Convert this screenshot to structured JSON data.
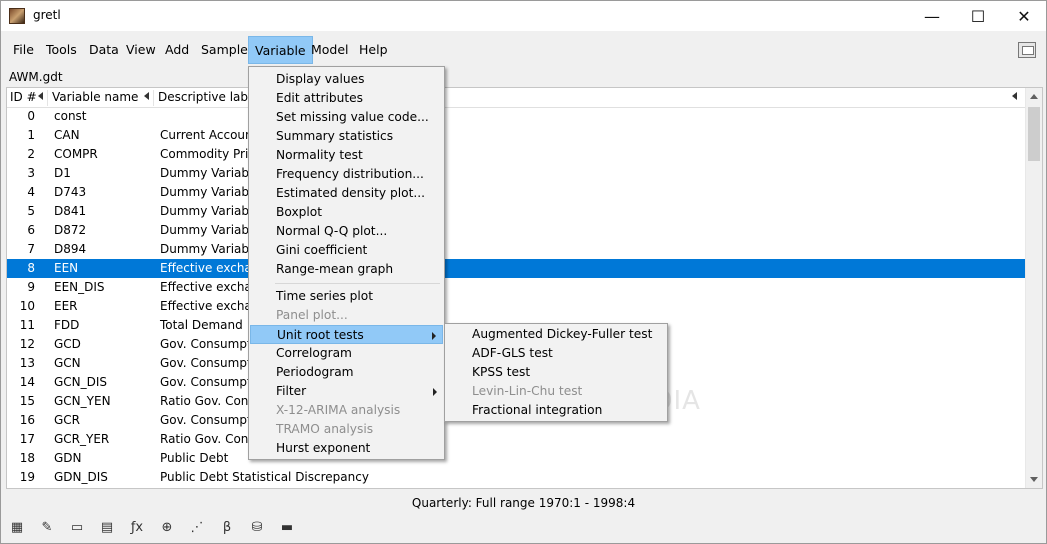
{
  "window": {
    "title": "gretl",
    "minimize": "—",
    "maximize": "☐",
    "close": "✕"
  },
  "menubar": [
    "File",
    "Tools",
    "Data",
    "View",
    "Add",
    "Sample",
    "Variable",
    "Model",
    "Help"
  ],
  "filename": "AWM.gdt",
  "list": {
    "headers": {
      "id": "ID #",
      "name": "Variable name",
      "desc": "Descriptive label"
    },
    "rows": [
      {
        "id": "0",
        "name": "const",
        "desc": ""
      },
      {
        "id": "1",
        "name": "CAN",
        "desc": "Current Account"
      },
      {
        "id": "2",
        "name": "COMPR",
        "desc": "Commodity Pric"
      },
      {
        "id": "3",
        "name": "D1",
        "desc": "Dummy Variable"
      },
      {
        "id": "4",
        "name": "D743",
        "desc": "Dummy Variable"
      },
      {
        "id": "5",
        "name": "D841",
        "desc": "Dummy Variable"
      },
      {
        "id": "6",
        "name": "D872",
        "desc": "Dummy Variable"
      },
      {
        "id": "7",
        "name": "D894",
        "desc": "Dummy Variable"
      },
      {
        "id": "8",
        "name": "EEN",
        "desc": "Effective exchang"
      },
      {
        "id": "9",
        "name": "EEN_DIS",
        "desc": "Effective exchang"
      },
      {
        "id": "10",
        "name": "EER",
        "desc": "Effective exchang"
      },
      {
        "id": "11",
        "name": "FDD",
        "desc": "Total Demand"
      },
      {
        "id": "12",
        "name": "GCD",
        "desc": "Gov. Consumptio"
      },
      {
        "id": "13",
        "name": "GCN",
        "desc": "Gov. Consumptio"
      },
      {
        "id": "14",
        "name": "GCN_DIS",
        "desc": "Gov. Consumptio"
      },
      {
        "id": "15",
        "name": "GCN_YEN",
        "desc": "Ratio Gov. Consu"
      },
      {
        "id": "16",
        "name": "GCR",
        "desc": "Gov. Consumptio"
      },
      {
        "id": "17",
        "name": "GCR_YER",
        "desc": "Ratio Gov. Consu"
      },
      {
        "id": "18",
        "name": "GDN",
        "desc": "Public Debt"
      },
      {
        "id": "19",
        "name": "GDN_DIS",
        "desc": "Public Debt Statistical Discrepancy"
      }
    ]
  },
  "status": "Quarterly: Full range 1970:1 - 1998:4",
  "variable_menu": {
    "group1": [
      "Display values",
      "Edit attributes",
      "Set missing value code...",
      "Summary statistics",
      "Normality test",
      "Frequency distribution...",
      "Estimated density plot...",
      "Boxplot",
      "Normal Q-Q plot...",
      "Gini coefficient",
      "Range-mean graph"
    ],
    "group2": [
      {
        "label": "Time series plot",
        "disabled": false
      },
      {
        "label": "Panel plot...",
        "disabled": true
      },
      {
        "label": "Unit root tests",
        "disabled": false,
        "submenu": true,
        "highlighted": true
      },
      {
        "label": "Correlogram",
        "disabled": false
      },
      {
        "label": "Periodogram",
        "disabled": false
      },
      {
        "label": "Filter",
        "disabled": false,
        "submenu": true
      },
      {
        "label": "X-12-ARIMA analysis",
        "disabled": true
      },
      {
        "label": "TRAMO analysis",
        "disabled": true
      },
      {
        "label": "Hurst exponent",
        "disabled": false
      }
    ]
  },
  "unit_root_submenu": [
    {
      "label": "Augmented Dickey-Fuller test",
      "disabled": false
    },
    {
      "label": "ADF-GLS test",
      "disabled": false
    },
    {
      "label": "KPSS test",
      "disabled": false
    },
    {
      "label": "Levin-Lin-Chu test",
      "disabled": true
    },
    {
      "label": "Fractional integration",
      "disabled": false
    }
  ],
  "toolbar_icons": [
    "calculator-icon",
    "edit-icon",
    "terminal-icon",
    "table-icon",
    "function-icon",
    "help-icon",
    "scatter-icon",
    "beta-icon",
    "database-icon",
    "folder-icon"
  ],
  "watermark": "SOFTPEDIA"
}
